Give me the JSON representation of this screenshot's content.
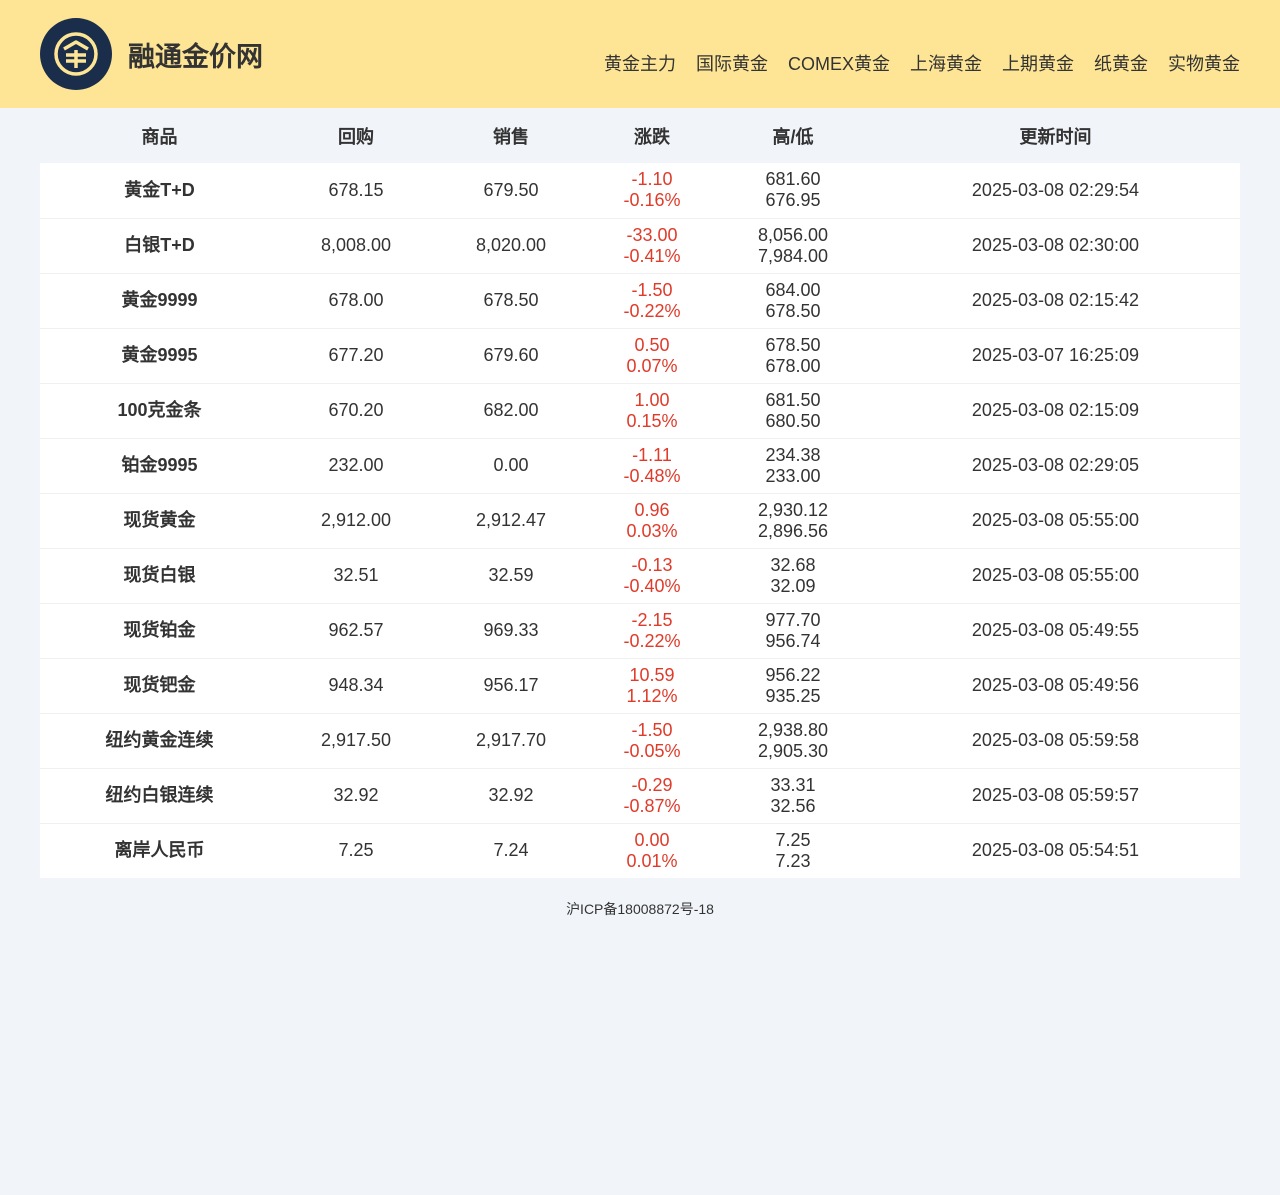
{
  "site": {
    "name": "融通金价网"
  },
  "nav": [
    "黄金主力",
    "国际黄金",
    "COMEX黄金",
    "上海黄金",
    "上期黄金",
    "纸黄金",
    "实物黄金"
  ],
  "table": {
    "headers": [
      "商品",
      "回购",
      "销售",
      "涨跌",
      "高/低",
      "更新时间"
    ],
    "rows": [
      {
        "name": "黄金T+D",
        "buy": "678.15",
        "sell": "679.50",
        "change": "-1.10",
        "pct": "-0.16%",
        "high": "681.60",
        "low": "676.95",
        "time": "2025-03-08 02:29:54"
      },
      {
        "name": "白银T+D",
        "buy": "8,008.00",
        "sell": "8,020.00",
        "change": "-33.00",
        "pct": "-0.41%",
        "high": "8,056.00",
        "low": "7,984.00",
        "time": "2025-03-08 02:30:00"
      },
      {
        "name": "黄金9999",
        "buy": "678.00",
        "sell": "678.50",
        "change": "-1.50",
        "pct": "-0.22%",
        "high": "684.00",
        "low": "678.50",
        "time": "2025-03-08 02:15:42"
      },
      {
        "name": "黄金9995",
        "buy": "677.20",
        "sell": "679.60",
        "change": "0.50",
        "pct": "0.07%",
        "high": "678.50",
        "low": "678.00",
        "time": "2025-03-07 16:25:09"
      },
      {
        "name": "100克金条",
        "buy": "670.20",
        "sell": "682.00",
        "change": "1.00",
        "pct": "0.15%",
        "high": "681.50",
        "low": "680.50",
        "time": "2025-03-08 02:15:09"
      },
      {
        "name": "铂金9995",
        "buy": "232.00",
        "sell": "0.00",
        "change": "-1.11",
        "pct": "-0.48%",
        "high": "234.38",
        "low": "233.00",
        "time": "2025-03-08 02:29:05"
      },
      {
        "name": "现货黄金",
        "buy": "2,912.00",
        "sell": "2,912.47",
        "change": "0.96",
        "pct": "0.03%",
        "high": "2,930.12",
        "low": "2,896.56",
        "time": "2025-03-08 05:55:00"
      },
      {
        "name": "现货白银",
        "buy": "32.51",
        "sell": "32.59",
        "change": "-0.13",
        "pct": "-0.40%",
        "high": "32.68",
        "low": "32.09",
        "time": "2025-03-08 05:55:00"
      },
      {
        "name": "现货铂金",
        "buy": "962.57",
        "sell": "969.33",
        "change": "-2.15",
        "pct": "-0.22%",
        "high": "977.70",
        "low": "956.74",
        "time": "2025-03-08 05:49:55"
      },
      {
        "name": "现货钯金",
        "buy": "948.34",
        "sell": "956.17",
        "change": "10.59",
        "pct": "1.12%",
        "high": "956.22",
        "low": "935.25",
        "time": "2025-03-08 05:49:56"
      },
      {
        "name": "纽约黄金连续",
        "buy": "2,917.50",
        "sell": "2,917.70",
        "change": "-1.50",
        "pct": "-0.05%",
        "high": "2,938.80",
        "low": "2,905.30",
        "time": "2025-03-08 05:59:58"
      },
      {
        "name": "纽约白银连续",
        "buy": "32.92",
        "sell": "32.92",
        "change": "-0.29",
        "pct": "-0.87%",
        "high": "33.31",
        "low": "32.56",
        "time": "2025-03-08 05:59:57"
      },
      {
        "name": "离岸人民币",
        "buy": "7.25",
        "sell": "7.24",
        "change": "0.00",
        "pct": "0.01%",
        "high": "7.25",
        "low": "7.23",
        "time": "2025-03-08 05:54:51"
      }
    ]
  },
  "footer": {
    "icp": "沪ICP备18008872号-18"
  },
  "colors": {
    "header_bg": "#fde595",
    "page_bg": "#f1f5f9",
    "logo_bg": "#1a2d4a",
    "logo_fg": "#fde595",
    "change_color": "#e03b2a"
  },
  "icons": {
    "logo": "coin-logo-icon"
  }
}
